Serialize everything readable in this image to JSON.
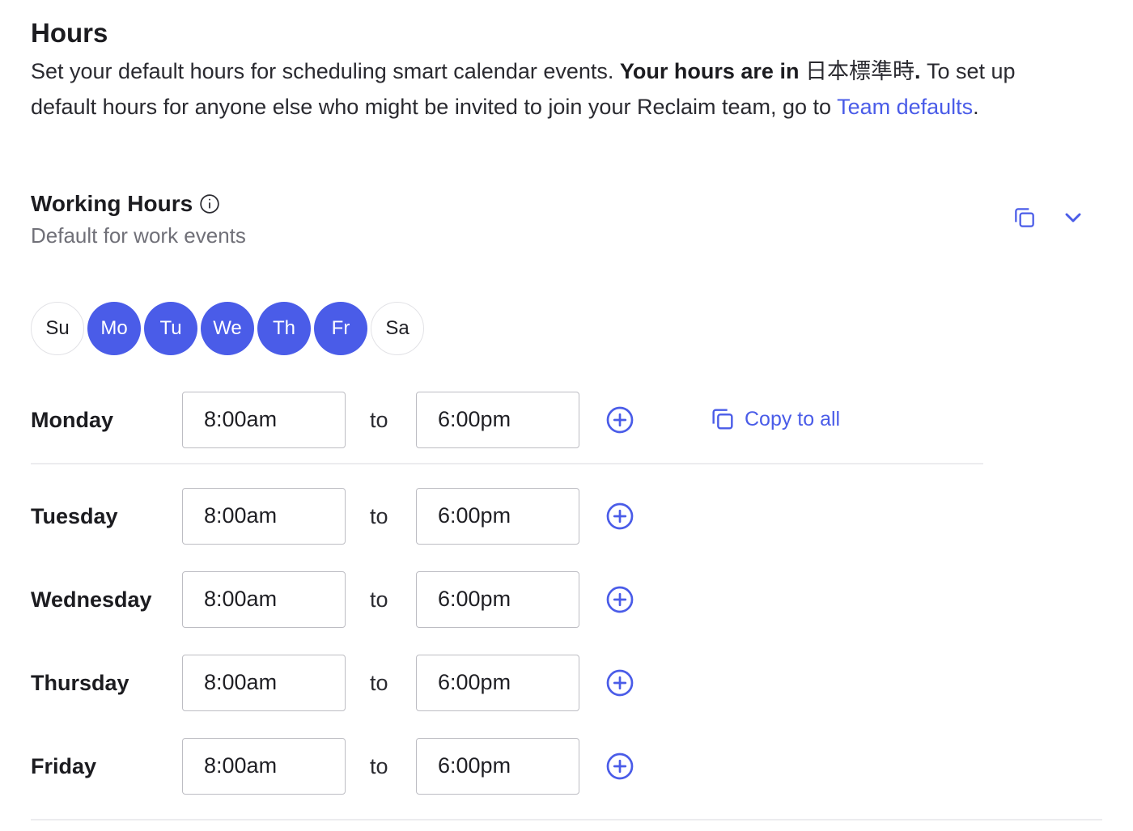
{
  "header": {
    "title": "Hours",
    "desc_part1": "Set your default hours for scheduling smart calendar events. ",
    "desc_bold": "Your hours are in",
    "desc_tz": " 日本標準時",
    "desc_bold_dot": ".",
    "desc_part2": " To set up default hours for anyone else who might be invited to join your Reclaim team, go to ",
    "desc_link": "Team defaults",
    "desc_end": "."
  },
  "working_hours": {
    "title": "Working Hours",
    "subtitle": "Default for work events",
    "icons": {
      "info": "info-icon",
      "copy": "copy-icon",
      "collapse": "chevron-down-icon"
    }
  },
  "days": [
    {
      "label": "Su",
      "active": false
    },
    {
      "label": "Mo",
      "active": true
    },
    {
      "label": "Tu",
      "active": true
    },
    {
      "label": "We",
      "active": true
    },
    {
      "label": "Th",
      "active": true
    },
    {
      "label": "Fr",
      "active": true
    },
    {
      "label": "Sa",
      "active": false
    }
  ],
  "schedule": [
    {
      "day": "Monday",
      "start": "8:00am",
      "end": "6:00pm"
    },
    {
      "day": "Tuesday",
      "start": "8:00am",
      "end": "6:00pm"
    },
    {
      "day": "Wednesday",
      "start": "8:00am",
      "end": "6:00pm"
    },
    {
      "day": "Thursday",
      "start": "8:00am",
      "end": "6:00pm"
    },
    {
      "day": "Friday",
      "start": "8:00am",
      "end": "6:00pm"
    }
  ],
  "to_label": "to",
  "copy_to_all_label": "Copy to all",
  "colors": {
    "accent": "#4a5ce8",
    "text": "#1c1c20",
    "muted": "#707078",
    "border": "#bdbdc3"
  }
}
